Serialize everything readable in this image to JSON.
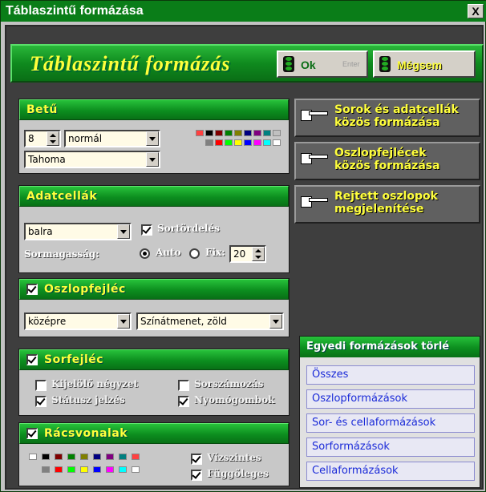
{
  "window": {
    "title": "Táblaszintű formázása",
    "close_glyph": "X"
  },
  "banner": {
    "title": "Táblaszintű formázás",
    "ok_label": "Ok",
    "ok_hint": "Enter",
    "cancel_label": "Mégsem"
  },
  "betu": {
    "header": "Betű",
    "size": "8",
    "style": "normál",
    "font": "Tahoma",
    "palette_top": [
      "#ff4040",
      "#000000",
      "#800000",
      "#008000",
      "#808000",
      "#000080",
      "#800080",
      "#008080",
      "#c0c0c0"
    ],
    "palette_bottom": [
      "#808080",
      "#ff0000",
      "#00ff00",
      "#ffff00",
      "#0000ff",
      "#ff00ff",
      "#00ffff",
      "#ffffff"
    ]
  },
  "adatcellak": {
    "header": "Adatcellák",
    "align": "balra",
    "wrap_label": "Sortördelés",
    "row_height_label": "Sormagasság:",
    "auto_label": "Auto",
    "fix_label": "Fix:",
    "fix_value": "20"
  },
  "oszlopfejlec": {
    "header": "Oszlopfejléc",
    "align": "középre",
    "fill": "Színátmenet, zöld"
  },
  "sorfejlec": {
    "header": "Sorfejléc",
    "selector_label": "Kijelölő négyzet",
    "numbering_label": "Sorszámozás",
    "status_label": "Státusz jelzés",
    "buttons_label": "Nyomógombok"
  },
  "racsvonalak": {
    "header": "Rácsvonalak",
    "horizontal_label": "Vízszintes",
    "vertical_label": "Függőleges",
    "palette_top": [
      "#ffffff",
      "#000000",
      "#800000",
      "#008000",
      "#808000",
      "#000080",
      "#800080",
      "#008080",
      "#ff4040"
    ],
    "palette_bottom": [
      "#808080",
      "#ff0000",
      "#00ff00",
      "#ffff00",
      "#0000ff",
      "#ff00ff",
      "#00ffff",
      "#ffffff"
    ]
  },
  "right_buttons": [
    {
      "line1": "Sorok és adatcellák",
      "line2": "közös formázása"
    },
    {
      "line1": "Oszlopfejlécek",
      "line2": "közös formázása"
    },
    {
      "line1": "Rejtett oszlopok",
      "line2": "megjelenítése"
    }
  ],
  "egyedi": {
    "header": "Egyedi formázások törlé",
    "buttons": [
      "Összes",
      "Oszlopformázások",
      "Sor- és cellaformázások",
      "Sorformázások",
      "Cellaformázások"
    ]
  }
}
